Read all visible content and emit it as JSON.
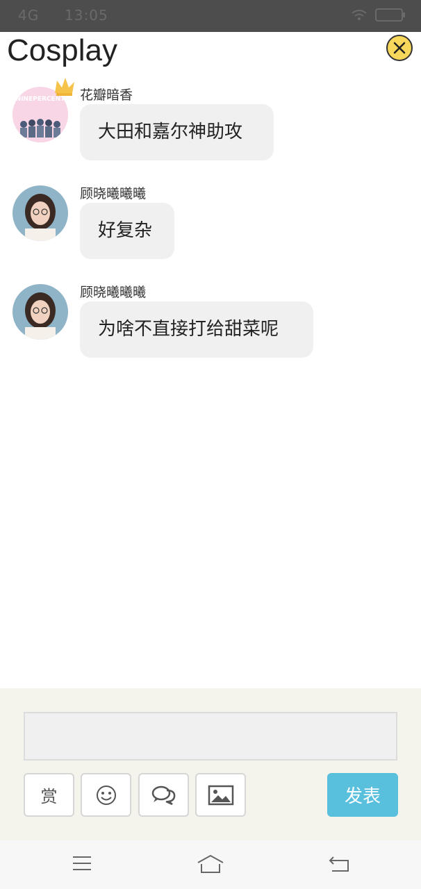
{
  "status_bar": {
    "carrier": "4G",
    "time": "13:05",
    "icons": [
      "wifi-icon",
      "battery-icon"
    ]
  },
  "header": {
    "title": "Cosplay",
    "close_icon": "close-icon"
  },
  "messages": [
    {
      "sender": "花瓣暗香",
      "text": "大田和嘉尔神助攻",
      "avatar_text": "NINEPERCENT",
      "has_crown": true
    },
    {
      "sender": "顾晓曦曦曦",
      "text": "好复杂"
    },
    {
      "sender": "顾晓曦曦曦",
      "text": "为啥不直接打给甜菜呢"
    }
  ],
  "composer": {
    "input_value": "",
    "reward_label": "赏",
    "send_label": "发表",
    "tools": [
      "emoji-icon",
      "comments-icon",
      "image-icon"
    ]
  },
  "nav": [
    "menu-icon",
    "home-icon",
    "back-icon"
  ],
  "colors": {
    "send_button": "#58bfdc",
    "bubble": "#f0f0f0",
    "composer_bg": "#f4f3ec",
    "close_button": "#f7d85a"
  }
}
